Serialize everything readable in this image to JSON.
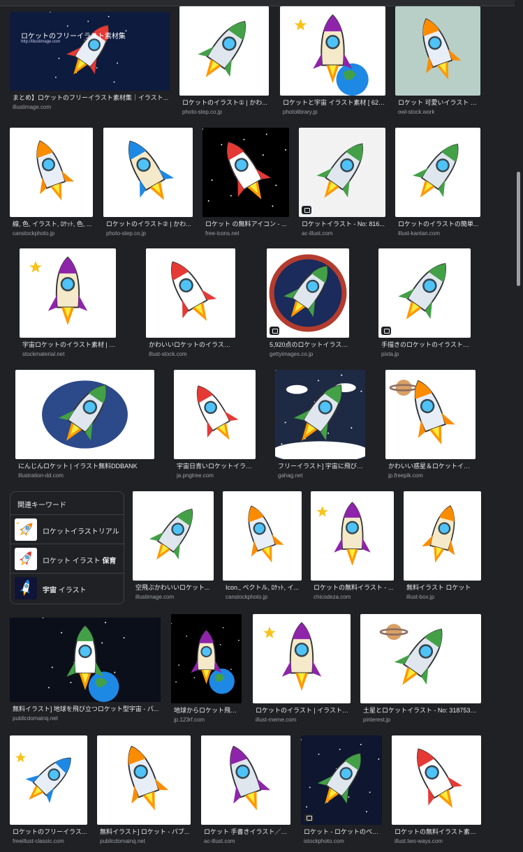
{
  "results": [
    {
      "title": "まとめ】ロケットのフリーイラスト素材集｜イラスト...",
      "source": "illustimage.com",
      "bg": "#0d1b3e",
      "icon": "space-rocket-banner-image",
      "banner": "ロケットのフリーイラスト素材集",
      "banner_sub": "http://illustimage.com",
      "badge": false
    },
    {
      "title": "ロケットのイラスト① | かわ...",
      "source": "photo-step.co.jp",
      "bg": "#ffffff",
      "icon": "yellow-rocket-image",
      "badge": false
    },
    {
      "title": "ロケットと宇宙 イラスト素材 [ 622...",
      "source": "photolibrary.jp",
      "bg": "#ffffff",
      "icon": "rocket-earth-image",
      "badge": false
    },
    {
      "title": "ロケット 可愛いイラスト フ...",
      "source": "owl-stock.work",
      "bg": "#b8cfc8",
      "icon": "cute-rocket-image",
      "badge": false
    },
    {
      "title": "線, 色, イラスト, ﾛｹｯﾄ, 色, ...",
      "source": "canstockphoto.jp",
      "bg": "#ffffff",
      "icon": "blue-rocket-image",
      "badge": false
    },
    {
      "title": "ロケットのイラスト② | かわ...",
      "source": "photo-step.co.jp",
      "bg": "#ffffff",
      "icon": "blue-rocket-diagonal-image",
      "badge": false
    },
    {
      "title": "ロケット の無料アイコン - ...",
      "source": "free-icons.net",
      "bg": "#000000",
      "icon": "shuttle-rocket-image",
      "badge": false
    },
    {
      "title": "ロケットイラスト - No: 816...",
      "source": "ac-illust.com",
      "bg": "#f2f2f2",
      "icon": "silver-rocket-image",
      "badge": true
    },
    {
      "title": "ロケットのイラストの簡単...",
      "source": "illust-kantan.com",
      "bg": "#ffffff",
      "icon": "simple-rocket-image",
      "badge": false
    },
    {
      "title": "宇宙ロケットのイラスト素材 | 商用可...",
      "source": "stockmaterial.net",
      "bg": "#ffffff",
      "icon": "cream-rocket-image",
      "badge": false
    },
    {
      "title": "かわいいロケットのイラスト - イラ...",
      "source": "illust-stock.com",
      "bg": "#ffffff",
      "icon": "cartoon-rocket-image",
      "badge": false
    },
    {
      "title": "5,920点のロケットイラスト素材 - ...",
      "source": "gettyimages.co.jp",
      "bg": "#ffffff",
      "icon": "rocket-emblem-image",
      "badge": true
    },
    {
      "title": "手描きのロケットのイラスト素材 [83...",
      "source": "pixta.jp",
      "bg": "#ffffff",
      "icon": "sketch-rocket-image",
      "badge": true
    },
    {
      "title": "にんじんロケット | イラスト無料DDBANK",
      "source": "illustration-dd.com",
      "bg": "#ffffff",
      "icon": "carrot-rocket-image",
      "badge": false
    },
    {
      "title": "宇宙日青いロケットイラスト...",
      "source": "ja.pngtree.com",
      "bg": "#ffffff",
      "icon": "striped-rocket-image",
      "badge": false
    },
    {
      "title": "フリーイラスト] 宇宙に飛び立つ...",
      "source": "gahag.net",
      "bg": "#1e2a44",
      "icon": "launch-clouds-image",
      "badge": false
    },
    {
      "title": "かわいい惑星＆ロケットイラスト...",
      "source": "jp.freepik.com",
      "bg": "#ffffff",
      "icon": "planets-set-image",
      "badge": false
    },
    {
      "title": "空飛ぶかわいいロケット...",
      "source": "illustimage.com",
      "bg": "#ffffff",
      "icon": "flying-rocket-image",
      "badge": false
    },
    {
      "title": "Icon., ベクトル, ﾛｹｯﾄ, イ...",
      "source": "canstockphoto.jp",
      "bg": "#ffffff",
      "icon": "navy-rocket-image",
      "badge": false
    },
    {
      "title": "ロケットの無料イラスト - ...",
      "source": "chicodeza.com",
      "bg": "#ffffff",
      "icon": "launch-tower-image",
      "badge": false
    },
    {
      "title": "無料イラスト ロケット",
      "source": "illust-box.jp",
      "bg": "#ffffff",
      "icon": "illustbox-rocket-image",
      "badge": false
    },
    {
      "title": "無料イラスト] 地球を飛び立つロケット型宇宙 - パ...",
      "source": "publicdomainq.net",
      "bg": "#0b0f1a",
      "icon": "earth-orbit-rocket-image",
      "badge": false
    },
    {
      "title": "地球からロケット飛ぶ ...",
      "source": "jp.123rf.com",
      "bg": "#000000",
      "icon": "globe-rocket-image",
      "badge": false
    },
    {
      "title": "ロケットのイラスト | イラストメ...",
      "source": "illust-meme.com",
      "bg": "#ffffff",
      "icon": "metal-rocket-image",
      "badge": false
    },
    {
      "title": "土星とロケットイラスト - No: 318753／...",
      "source": "pinterest.jp",
      "bg": "#ffffff",
      "icon": "saturn-rocket-image",
      "badge": false
    },
    {
      "title": "ロケットのフリーイラス...",
      "source": "freeillust-classic.com",
      "bg": "#ffffff",
      "icon": "red-nose-rocket-image",
      "badge": false
    },
    {
      "title": "無料イラスト] ロケット - パブ...",
      "source": "publicdomainq.net",
      "bg": "#ffffff",
      "icon": "fire-rocket-image",
      "badge": false
    },
    {
      "title": "ロケット 手書きイラスト／無...",
      "source": "ac-illust.com",
      "bg": "#ffffff",
      "icon": "hand-drawn-rocket-image",
      "badge": false
    },
    {
      "title": "ロケット - ロケットのベク...",
      "source": "istockphoto.com",
      "bg": "#0e1630",
      "icon": "istock-rocket-image",
      "badge": true
    },
    {
      "title": "ロケットの無料イラスト素材 ...",
      "source": "illust.two-ways.com",
      "bg": "#ffffff",
      "icon": "outline-rocket-image",
      "badge": false
    }
  ],
  "related": {
    "title": "関連キーワード",
    "items": [
      {
        "pre": "ロケットイラストリアル",
        "bold": "",
        "post": "",
        "icon": "realistic-rocket-thumb-icon",
        "bg": "#ffffff"
      },
      {
        "pre": "ロケット イラスト ",
        "bold": "保育",
        "post": "",
        "icon": "nursery-rocket-thumb-icon",
        "bg": "#ffffff"
      },
      {
        "pre": "",
        "bold": "宇宙",
        "post": " イラスト",
        "icon": "space-thumb-icon",
        "bg": "#101436"
      }
    ]
  }
}
